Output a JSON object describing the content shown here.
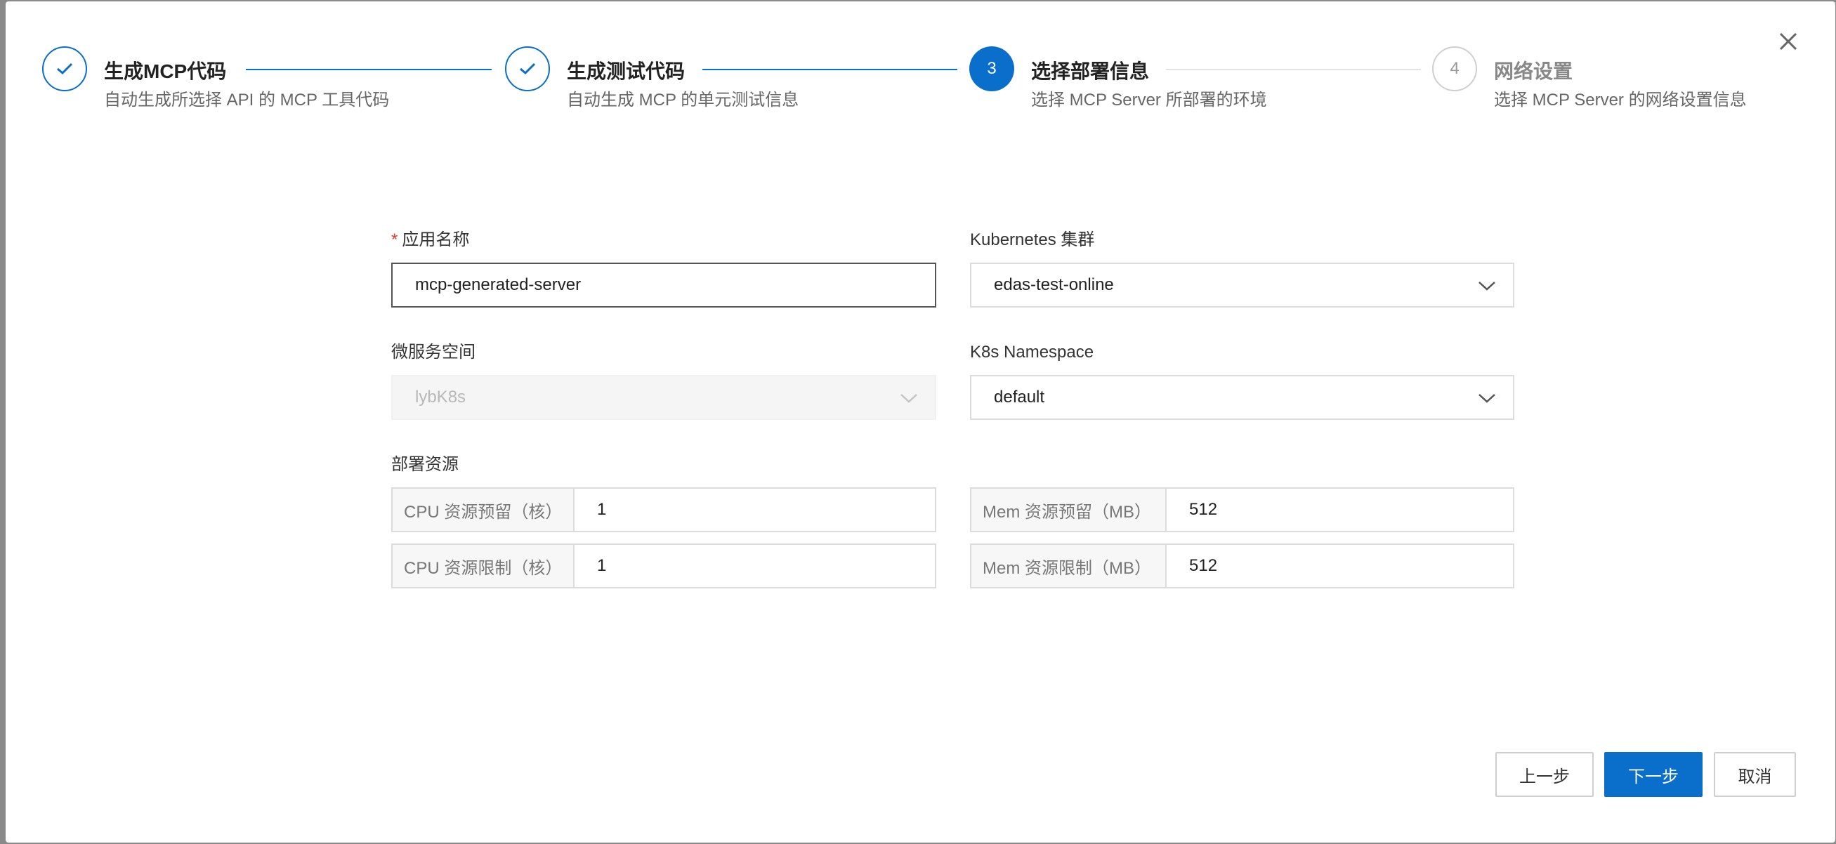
{
  "steps": [
    {
      "title": "生成MCP代码",
      "desc": "自动生成所选择 API 的 MCP 工具代码",
      "status": "done"
    },
    {
      "title": "生成测试代码",
      "desc": "自动生成 MCP 的单元测试信息",
      "status": "done"
    },
    {
      "number": "3",
      "title": "选择部署信息",
      "desc": "选择 MCP Server 所部署的环境",
      "status": "active"
    },
    {
      "number": "4",
      "title": "网络设置",
      "desc": "选择 MCP Server 的网络设置信息",
      "status": "pending"
    }
  ],
  "form": {
    "app_name": {
      "label": "应用名称",
      "required_mark": "*",
      "value": "mcp-generated-server"
    },
    "cluster": {
      "label": "Kubernetes 集群",
      "value": "edas-test-online"
    },
    "microservice_space": {
      "label": "微服务空间",
      "value": "lybK8s"
    },
    "namespace": {
      "label": "K8s Namespace",
      "value": "default"
    },
    "resources": {
      "label": "部署资源",
      "cpu_request": {
        "addon": "CPU 资源预留（核）",
        "value": "1"
      },
      "cpu_limit": {
        "addon": "CPU 资源限制（核）",
        "value": "1"
      },
      "mem_request": {
        "addon": "Mem 资源预留（MB）",
        "value": "512"
      },
      "mem_limit": {
        "addon": "Mem 资源限制（MB）",
        "value": "512"
      }
    }
  },
  "footer": {
    "prev": "上一步",
    "next": "下一步",
    "cancel": "取消"
  },
  "icons": {
    "close": "close-icon",
    "check": "check-icon",
    "chevron": "chevron-down-icon"
  },
  "colors": {
    "primary": "#0a6ecb",
    "required": "#e0372b"
  }
}
